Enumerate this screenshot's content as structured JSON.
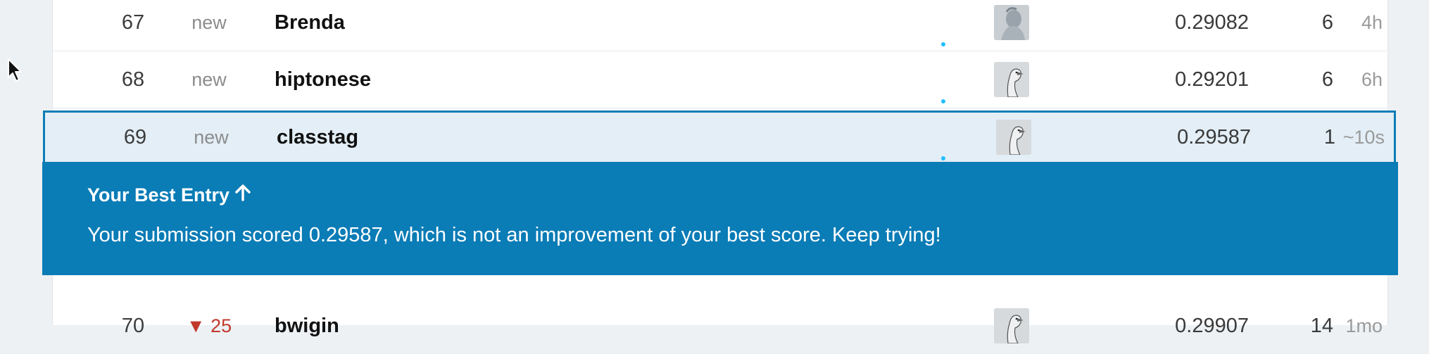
{
  "rows": [
    {
      "rank": "67",
      "change": "new",
      "team": "Brenda",
      "score": "0.29082",
      "entries": "6",
      "last": "4h",
      "avatar": "portrait-avatar"
    },
    {
      "rank": "68",
      "change": "new",
      "team": "hiptonese",
      "score": "0.29201",
      "entries": "6",
      "last": "6h",
      "avatar": "goose-avatar"
    },
    {
      "rank": "69",
      "change": "new",
      "team": "classtag",
      "score": "0.29587",
      "entries": "1",
      "last": "~10s",
      "avatar": "goose-avatar"
    },
    {
      "rank": "70",
      "change": "▼ 25",
      "team": "bwigin",
      "score": "0.29907",
      "entries": "14",
      "last": "1mo",
      "avatar": "goose-avatar"
    }
  ],
  "banner": {
    "title": "Your Best Entry",
    "message": "Your submission scored 0.29587, which is not an improvement of your best score. Keep trying!"
  },
  "colors": {
    "highlight_border": "#0b7db6",
    "banner_bg": "#0a7cb6",
    "online_dot": "#20beff"
  },
  "icons": {
    "cursor": "mouse-pointer-icon",
    "banner_arrow": "arrow-up-icon"
  }
}
